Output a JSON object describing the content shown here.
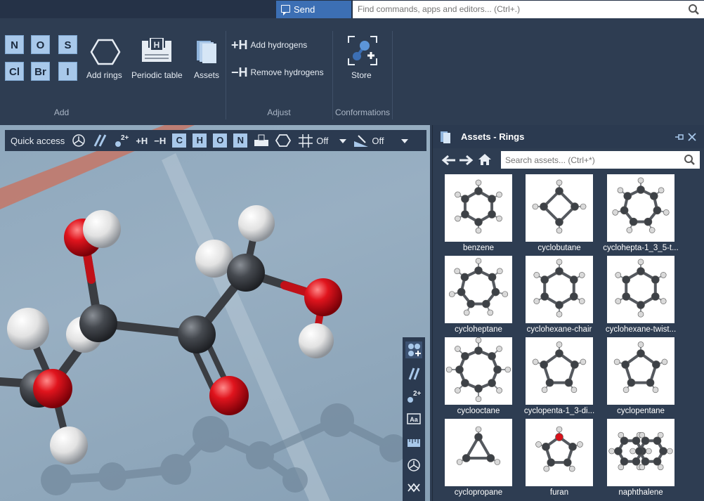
{
  "topbar": {
    "feedback_label": "Send feedback",
    "command_placeholder": "Find commands, apps and editors... (Ctrl+.)"
  },
  "ribbon": {
    "elements": [
      "N",
      "O",
      "S",
      "Cl",
      "Br",
      "I"
    ],
    "add_rings": "Add rings",
    "periodic_table": "Periodic table",
    "assets": "Assets",
    "add_hydrogens": "Add hydrogens",
    "remove_hydrogens": "Remove hydrogens",
    "store": "Store",
    "groups": {
      "add": "Add",
      "adjust": "Adjust",
      "conformations": "Conformations"
    }
  },
  "quick_access": {
    "label": "Quick access",
    "add_h": "+H",
    "remove_h": "−H",
    "elements": [
      "C",
      "H",
      "O",
      "N"
    ],
    "grid_state": "Off",
    "snap_state": "Off"
  },
  "assets_panel": {
    "title": "Assets - Rings",
    "search_placeholder": "Search assets... (Ctrl+*)",
    "items": [
      {
        "name": "benzene"
      },
      {
        "name": "cyclobutane"
      },
      {
        "name": "cyclohepta-1_3_5-t..."
      },
      {
        "name": "cycloheptane"
      },
      {
        "name": "cyclohexane-chair"
      },
      {
        "name": "cyclohexane-twist..."
      },
      {
        "name": "cyclooctane"
      },
      {
        "name": "cyclopenta-1_3-di..."
      },
      {
        "name": "cyclopentane"
      },
      {
        "name": "cyclopropane"
      },
      {
        "name": "furan"
      },
      {
        "name": "naphthalene"
      }
    ]
  },
  "colors": {
    "accent": "#3c6fb4",
    "element_button": "#a8c8ea",
    "panel_bg": "#2e3d52",
    "carbon": "#3a3d42",
    "oxygen": "#d8121b",
    "hydrogen": "#eaeaea"
  }
}
